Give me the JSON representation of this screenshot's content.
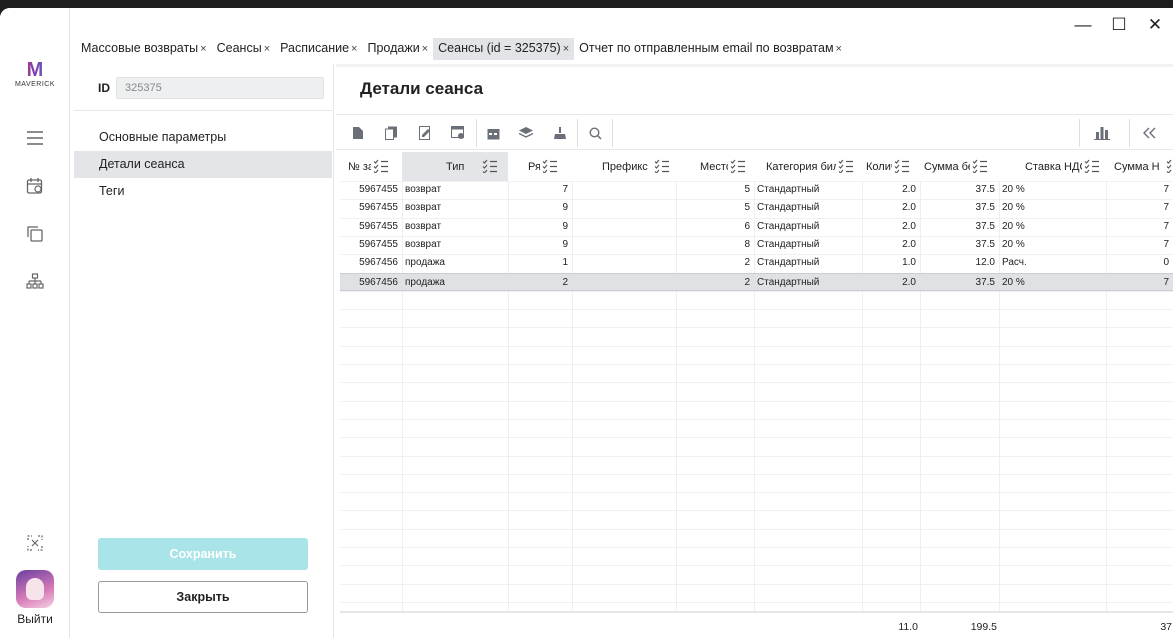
{
  "window": {
    "minimize": "—",
    "maximize": "☐",
    "close": "✕"
  },
  "rail": {
    "logo_letter": "M",
    "logo_text": "MAVERICK",
    "logout_label": "Выйти"
  },
  "tabs": [
    {
      "label": "Массовые возвраты",
      "close": "×"
    },
    {
      "label": "Сеансы",
      "close": "×"
    },
    {
      "label": "Расписание",
      "close": "×"
    },
    {
      "label": "Продажи",
      "close": "×"
    },
    {
      "label": "Сеансы (id = 325375)",
      "close": "×",
      "active": true
    },
    {
      "label": "Отчет по отправленным email по возвратам",
      "close": "×"
    }
  ],
  "left_panel": {
    "id_label": "ID",
    "id_value": "325375",
    "nav": [
      "Основные параметры",
      "Детали сеанса",
      "Теги"
    ],
    "save_label": "Сохранить",
    "close_label": "Закрыть"
  },
  "main": {
    "title": "Детали сеанса",
    "columns": [
      "№ за",
      "Тип",
      "Ря",
      "Префикс",
      "Место",
      "Категория биле",
      "Колич",
      "Сумма без",
      "Ставка НДС",
      "Сумма Н"
    ],
    "rows": [
      [
        "5967455",
        "возврат",
        "7",
        "",
        "5",
        "Стандартный",
        "2.0",
        "37.5",
        "20 %",
        "7"
      ],
      [
        "5967455",
        "возврат",
        "9",
        "",
        "5",
        "Стандартный",
        "2.0",
        "37.5",
        "20 %",
        "7"
      ],
      [
        "5967455",
        "возврат",
        "9",
        "",
        "6",
        "Стандартный",
        "2.0",
        "37.5",
        "20 %",
        "7"
      ],
      [
        "5967455",
        "возврат",
        "9",
        "",
        "8",
        "Стандартный",
        "2.0",
        "37.5",
        "20 %",
        "7"
      ],
      [
        "5967456",
        "продажа",
        "1",
        "",
        "2",
        "Стандартный",
        "1.0",
        "12.0",
        "Расч.",
        "0"
      ],
      [
        "5967456",
        "продажа",
        "2",
        "",
        "2",
        "Стандартный",
        "2.0",
        "37.5",
        "20 %",
        "7"
      ]
    ],
    "selected_row": 5,
    "totals": {
      "qty": "11.0",
      "sum": "199.5",
      "sum_vat": "37"
    }
  },
  "colors": {
    "accent": "#a8e4e8",
    "selected": "#dfe1e5",
    "tab_active": "#e2e4e8"
  }
}
